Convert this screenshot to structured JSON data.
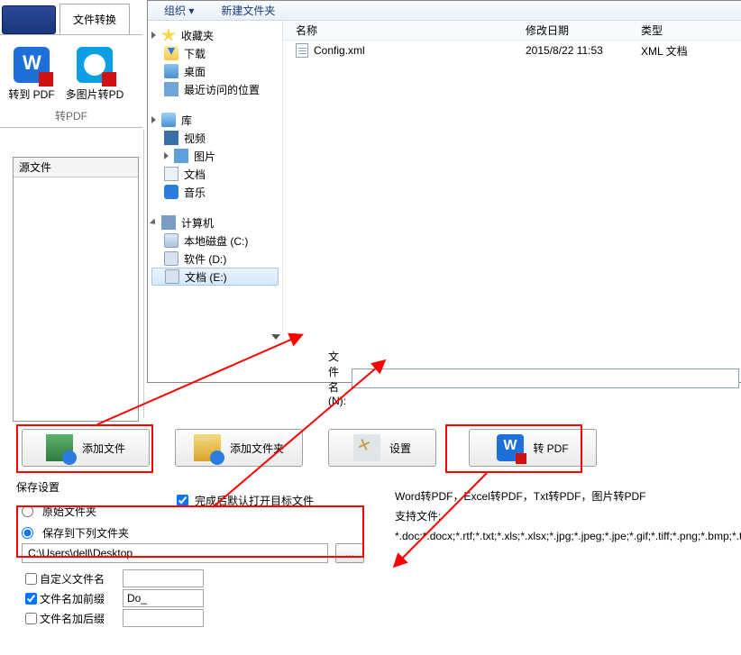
{
  "topTab": "文件转换",
  "tools": {
    "toPdf": "转到 PDF",
    "imgToPdf": "多图片转PD",
    "group": "转PDF"
  },
  "srcPanelTitle": "源文件",
  "dialog": {
    "toolbar": {
      "organize": "组织",
      "newFolder": "新建文件夹"
    },
    "tree": {
      "favorites": "收藏夹",
      "downloads": "下载",
      "desktop": "桌面",
      "recent": "最近访问的位置",
      "library": "库",
      "videos": "视频",
      "pictures": "图片",
      "documents": "文档",
      "music": "音乐",
      "computer": "计算机",
      "diskC": "本地磁盘 (C:)",
      "diskD": "软件 (D:)",
      "diskE": "文档 (E:)"
    },
    "columns": {
      "name": "名称",
      "date": "修改日期",
      "type": "类型"
    },
    "files": [
      {
        "name": "Config.xml",
        "date": "2015/8/22 11:53",
        "type": "XML 文档"
      }
    ],
    "filenameLabel": "文件名(N):"
  },
  "buttons": {
    "addFile": "添加文件",
    "addFolder": "添加文件夹",
    "settings": "设置",
    "convert": "转 PDF"
  },
  "settings": {
    "title": "保存设置",
    "origFolder": "原始文件夹",
    "saveToFolder": "保存到下列文件夹",
    "path": "C:\\Users\\dell\\Desktop",
    "browse": "...",
    "customName": "自定义文件名",
    "prefix": "文件名加前缀",
    "prefixVal": "Do_",
    "suffix": "文件名加后缀",
    "openAfter": "完成后默认打开目标文件"
  },
  "info": {
    "l1": "Word转PDF，Excel转PDF，Txt转PDF，图片转PDF",
    "l2": "支持文件:",
    "l3": "*.doc;*.docx;*.rtf;*.txt;*.xls;*.xlsx;*.jpg;*.jpeg;*.jpe;*.gif;*.tiff;*.png;*.bmp;*.tif;"
  },
  "chart_data": null
}
